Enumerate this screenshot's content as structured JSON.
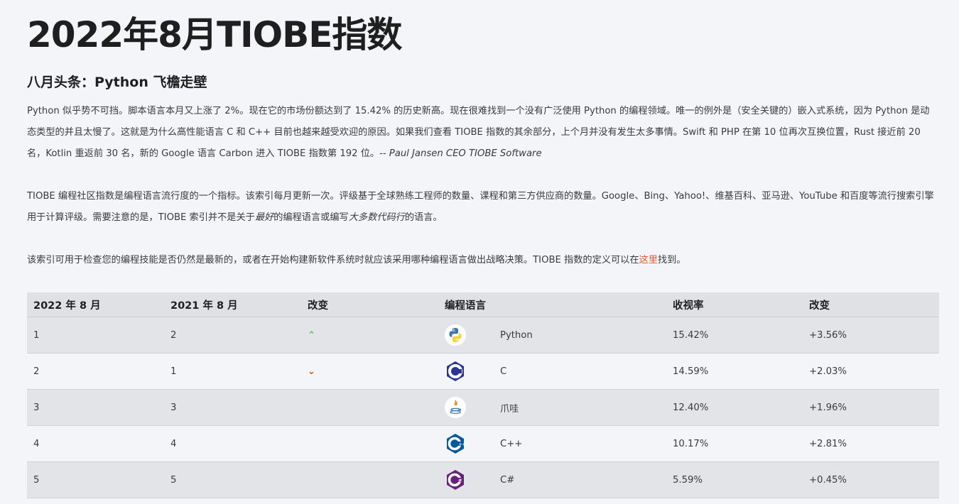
{
  "page": {
    "title": "2022年8月TIOBE指数",
    "subtitle": "八月头条：Python 飞檐走壁",
    "p1_text": "Python 似乎势不可挡。脚本语言本月又上涨了 2%。现在它的市场份额达到了 15.42% 的历史新高。现在很难找到一个没有广泛使用 Python 的编程领域。唯一的例外是（安全关键的）嵌入式系统，因为 Python 是动态类型的并且太慢了。这就是为什么高性能语言 C 和 C++ 目前也越来越受欢迎的原因。如果我们查看 TIOBE 指数的其余部分，上个月并没有发生太多事情。Swift 和 PHP 在第 10 位再次互换位置，Rust 接近前 20 名，Kotlin 重返前 30 名，新的 Google 语言 Carbon 进入 TIOBE 指数第 192 位。-- ",
    "p1_quote": "Paul Jansen CEO TIOBE Software",
    "p2_a": "TIOBE 编程社区指数是编程语言流行度的一个指标。该索引每月更新一次。评级基于全球熟练工程师的数量、课程和第三方供应商的数量。Google、Bing、Yahoo!、维基百科、亚马逊、YouTube 和百度等流行搜索引擎用于计算评级。需要注意的是，TIOBE 索引并不是关于",
    "p2_em1": "最好",
    "p2_b": "的编程语言或编写",
    "p2_em2": "大多数代码行",
    "p2_c": "的语言。",
    "p3_a": "该索引可用于检查您的编程技能是否仍然是最新的，或者在开始构建新软件系统时就应该采用哪种编程语言做出战略决策。TIOBE 指数的定义可以在",
    "p3_link": "这里",
    "p3_b": "找到。"
  },
  "table": {
    "headers": [
      "2022 年 8 月",
      "2021 年 8 月",
      "改变",
      "编程语言",
      "收视率",
      "改变"
    ],
    "rows": [
      {
        "rank": "1",
        "prev": "2",
        "trend": "up",
        "lang": "Python",
        "rating": "15.42%",
        "change": "+3.56%",
        "logo": "python-logo"
      },
      {
        "rank": "2",
        "prev": "1",
        "trend": "down",
        "lang": "C",
        "rating": "14.59%",
        "change": "+2.03%",
        "logo": "c-logo"
      },
      {
        "rank": "3",
        "prev": "3",
        "trend": "none",
        "lang": "爪哇",
        "rating": "12.40%",
        "change": "+1.96%",
        "logo": "java-logo"
      },
      {
        "rank": "4",
        "prev": "4",
        "trend": "none",
        "lang": "C++",
        "rating": "10.17%",
        "change": "+2.81%",
        "logo": "cpp-logo"
      },
      {
        "rank": "5",
        "prev": "5",
        "trend": "none",
        "lang": "C#",
        "rating": "5.59%",
        "change": "+0.45%",
        "logo": "csharp-logo"
      }
    ]
  },
  "icons": {
    "up": "^",
    "down": "v"
  },
  "colors": {
    "up": "#5cb85c",
    "down": "#e04b22",
    "link": "#e8563a"
  }
}
